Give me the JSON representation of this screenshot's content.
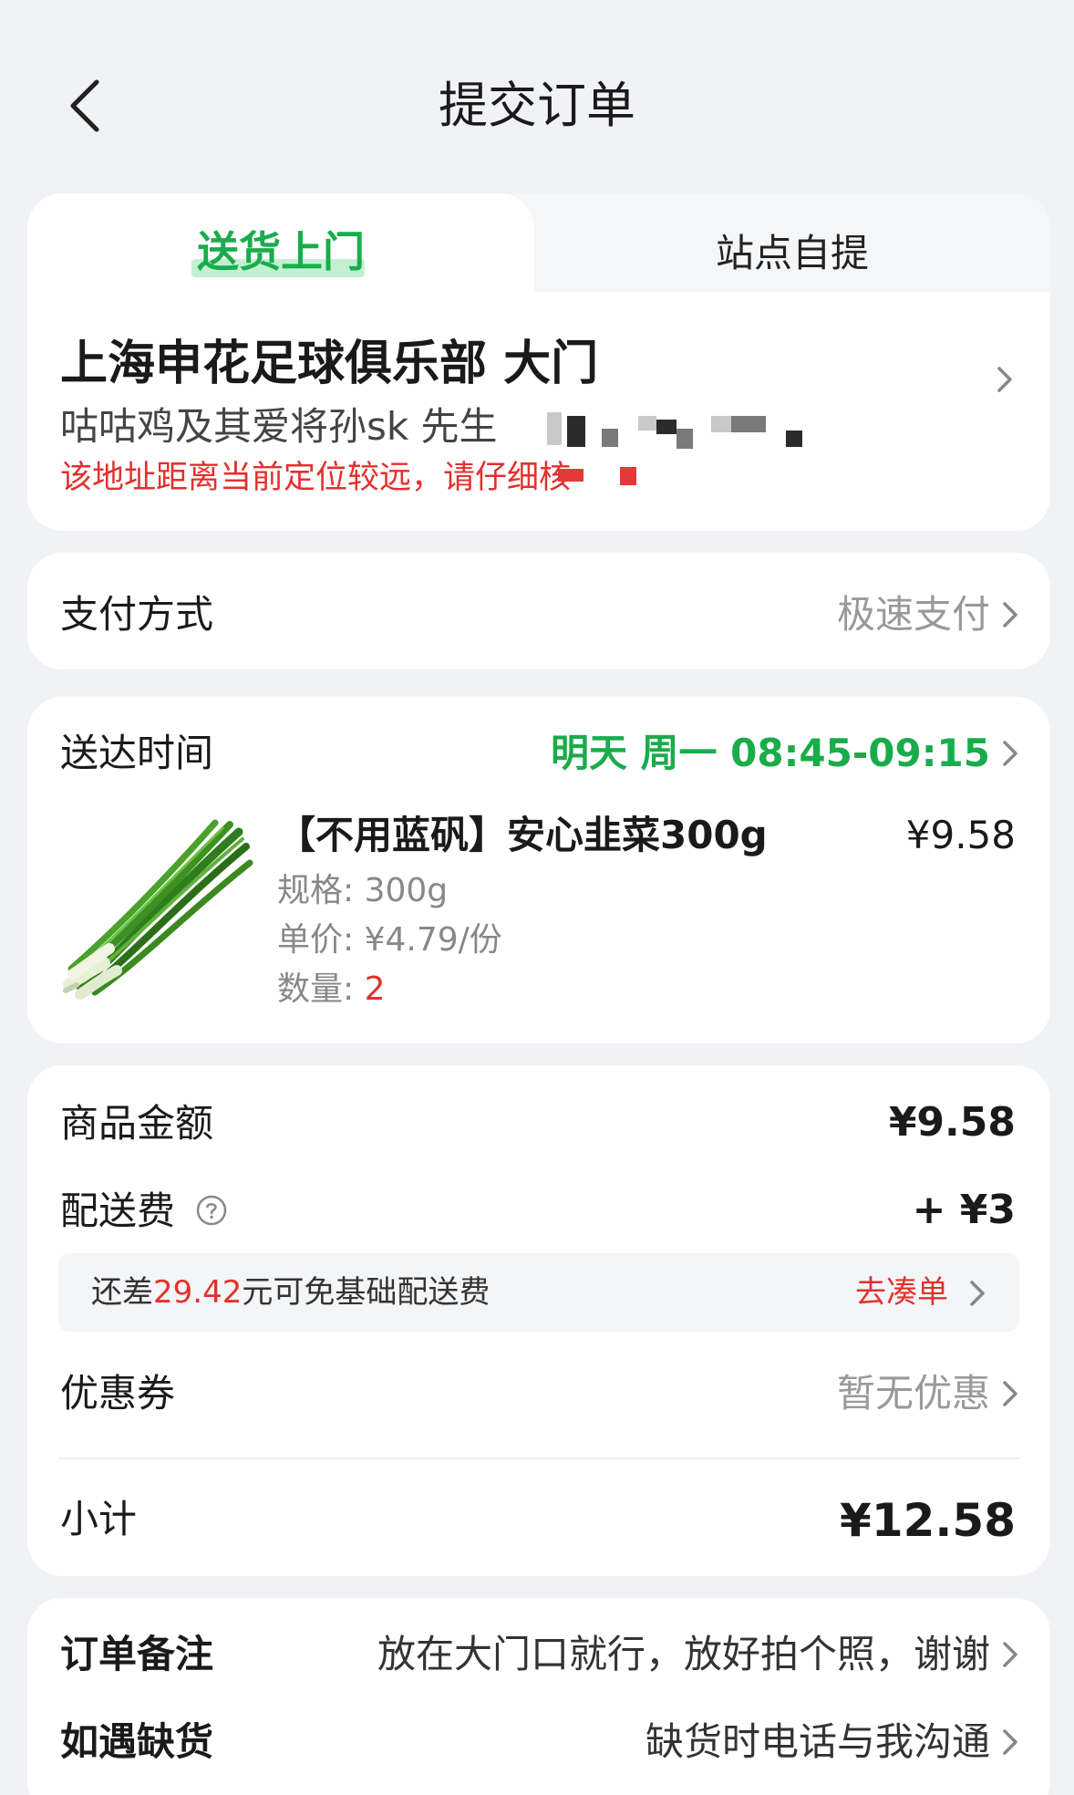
{
  "header": {
    "title": "提交订单"
  },
  "tabs": [
    {
      "label": "送货上门",
      "active": true
    },
    {
      "label": "站点自提",
      "active": false
    }
  ],
  "address": {
    "title": "上海申花足球俱乐部 大门",
    "contact": "咕咕鸡及其爱将孙sk 先生",
    "warning": "该地址距离当前定位较远，请仔细核"
  },
  "payment": {
    "label": "支付方式",
    "value": "极速支付"
  },
  "delivery_time": {
    "label": "送达时间",
    "value": "明天 周一 08:45-09:15"
  },
  "product": {
    "name": "【不用蓝矾】安心韭菜300g",
    "price": "¥9.58",
    "spec": "规格: 300g",
    "unit_price": "单价: ¥4.79/份",
    "qty_label": "数量: ",
    "qty": "2",
    "image": "chinese-chives-image"
  },
  "fees": {
    "goods_label": "商品金额",
    "goods_amount": "¥9.58",
    "delivery_label": "配送费",
    "delivery_amount": "+ ¥3",
    "promo_prefix": "还差",
    "promo_amount": "29.42",
    "promo_suffix": "元可免基础配送费",
    "promo_action": "去凑单",
    "coupon_label": "优惠券",
    "coupon_value": "暂无优惠",
    "subtotal_label": "小计",
    "subtotal": "¥12.58"
  },
  "notes": {
    "remark_label": "订单备注",
    "remark_value": "放在大门口就行，放好拍个照，谢谢",
    "shortage_label": "如遇缺货",
    "shortage_value": "缺货时电话与我沟通"
  },
  "colors": {
    "accent_green": "#1aac4b",
    "alert_red": "#e2312d",
    "background": "#f1f2f6"
  }
}
